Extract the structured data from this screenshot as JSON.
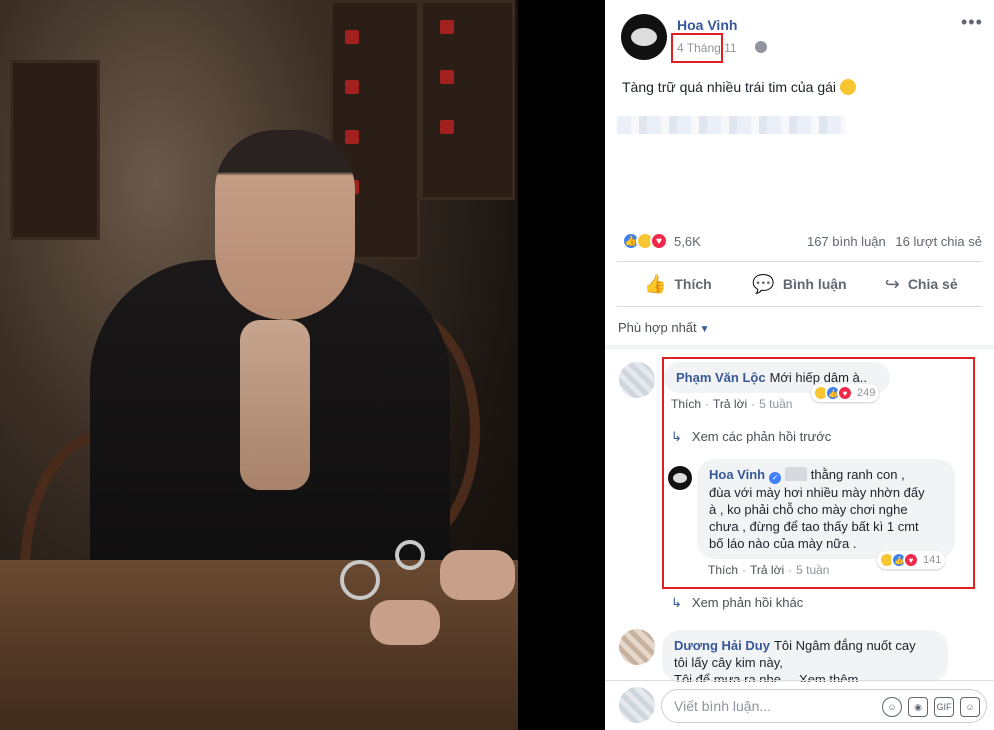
{
  "post": {
    "author": "Hoa Vinh",
    "date": "4 Tháng 11",
    "text": "Tàng trữ quá nhiều trái tim của gái",
    "reaction_count": "5,6K",
    "comments_count": "167 bình luận",
    "shares_count": "16 lượt chia sẻ"
  },
  "actions": {
    "like": "Thích",
    "comment": "Bình luận",
    "share": "Chia sẻ"
  },
  "sort_label": "Phù hợp nhất",
  "comments": [
    {
      "name": "Phạm Văn Lộc",
      "text": "Mới hiếp dâm à..",
      "like": "Thích",
      "reply": "Trả lời",
      "time": "5 tuần",
      "reactions": "249"
    },
    {
      "name": "Dương Hải Duy",
      "line1": "Tôi Ngâm đắng nuốt cay",
      "line2": "tôi lấy cây kim này,",
      "line3": "Tôi để mưa ra nhe ... Xem thêm"
    }
  ],
  "view_previous": "Xem các phản hồi trước",
  "reply": {
    "name": "Hoa Vinh",
    "line1": "thằng ranh con ,",
    "line2": "đùa với mày hơi nhiều mày nhờn đấy",
    "line3": "à , ko phải chỗ cho mày chơi nghe",
    "line4": "chưa , đừng để tao thấy bất kì 1 cmt",
    "line5": "bố láo nào của mày nữa .",
    "like": "Thích",
    "reply": "Trả lời",
    "time": "5 tuần",
    "reactions": "141"
  },
  "view_other": "Xem phản hồi khác",
  "composer": {
    "placeholder": "Viết bình luận..."
  },
  "colors": {
    "link": "#365899",
    "highlight": "#e02020",
    "like": "#3b82f0",
    "love": "#f02849",
    "haha": "#f7c531"
  }
}
